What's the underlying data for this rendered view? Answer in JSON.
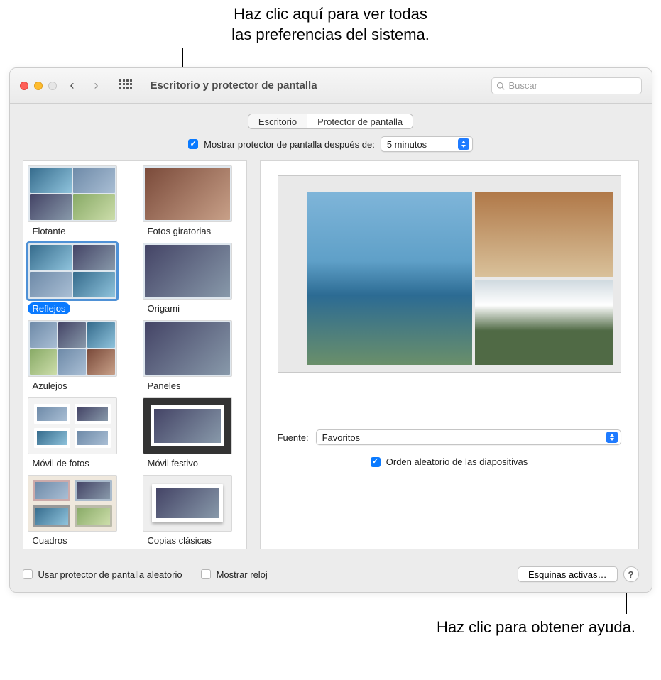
{
  "callouts": {
    "top": "Haz clic aquí para ver todas\nlas preferencias del sistema.",
    "bottom": "Haz clic para obtener ayuda."
  },
  "toolbar": {
    "title": "Escritorio y protector de pantalla",
    "search_placeholder": "Buscar"
  },
  "tabs": {
    "desktop": "Escritorio",
    "screensaver": "Protector de pantalla",
    "active": "screensaver"
  },
  "show_after": {
    "label": "Mostrar protector de pantalla después de:",
    "value": "5 minutos",
    "checked": true
  },
  "screensavers": [
    {
      "id": "flotante",
      "label": "Flotante",
      "selected": false
    },
    {
      "id": "fotos-giratorias",
      "label": "Fotos giratorias",
      "selected": false
    },
    {
      "id": "reflejos",
      "label": "Reflejos",
      "selected": true
    },
    {
      "id": "origami",
      "label": "Origami",
      "selected": false
    },
    {
      "id": "azulejos",
      "label": "Azulejos",
      "selected": false
    },
    {
      "id": "paneles",
      "label": "Paneles",
      "selected": false
    },
    {
      "id": "movil-fotos",
      "label": "Móvil de fotos",
      "selected": false
    },
    {
      "id": "movil-festivo",
      "label": "Móvil festivo",
      "selected": false
    },
    {
      "id": "cuadros",
      "label": "Cuadros",
      "selected": false
    },
    {
      "id": "copias-clasicas",
      "label": "Copias clásicas",
      "selected": false
    }
  ],
  "source": {
    "label": "Fuente:",
    "value": "Favoritos"
  },
  "random_slides": {
    "label": "Orden aleatorio de las diapositivas",
    "checked": true
  },
  "bottom": {
    "random_saver": {
      "label": "Usar protector de pantalla aleatorio",
      "checked": false
    },
    "show_clock": {
      "label": "Mostrar reloj",
      "checked": false
    },
    "hot_corners": "Esquinas activas…",
    "help": "?"
  }
}
